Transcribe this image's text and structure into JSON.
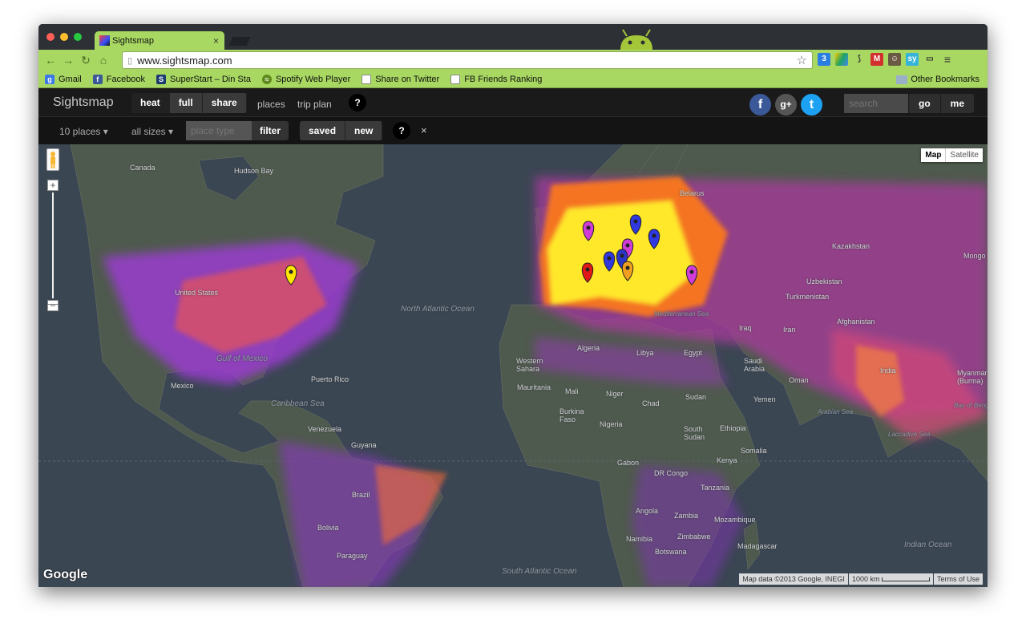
{
  "browser": {
    "tab_title": "Sightsmap",
    "tab_close": "×",
    "url": "www.sightsmap.com",
    "bookmarks": [
      {
        "label": "Gmail",
        "icon": "google-icon",
        "color": "#3b78e7"
      },
      {
        "label": "Facebook",
        "icon": "facebook-icon",
        "color": "#3b5998"
      },
      {
        "label": "SuperStart – Din Sta",
        "icon": "superstart-icon",
        "color": "#1d3b6e"
      },
      {
        "label": "Spotify Web Player",
        "icon": "spotify-icon",
        "color": "#5d8a1a"
      },
      {
        "label": "Share on Twitter",
        "icon": "page-icon",
        "color": "#ffffff"
      },
      {
        "label": "FB Friends Ranking",
        "icon": "page-icon",
        "color": "#ffffff"
      }
    ],
    "other_bookmarks": "Other Bookmarks",
    "extension_badge": "3"
  },
  "app": {
    "brand": "Sightsmap",
    "modes": [
      "heat",
      "full",
      "share"
    ],
    "links": [
      "places",
      "trip plan"
    ],
    "help": "?",
    "social": [
      {
        "glyph": "f",
        "icon": "facebook-icon",
        "color": "#3b5998"
      },
      {
        "glyph": "g+",
        "icon": "google-plus-icon",
        "color": "#555555"
      },
      {
        "glyph": "t",
        "icon": "twitter-icon",
        "color": "#1da1f2"
      }
    ],
    "search_placeholder": "search",
    "go": "go",
    "me": "me"
  },
  "filters": {
    "places": "10 places",
    "sizes": "all sizes",
    "place_type_placeholder": "place type",
    "filter": "filter",
    "saved": "saved",
    "new": "new",
    "help": "?",
    "close": "×"
  },
  "map": {
    "map_type": [
      "Map",
      "Satellite"
    ],
    "zoom_in": "+",
    "zoom_out": "−",
    "google": "Google",
    "attribution": "Map data ©2013 Google, INEGI",
    "scale": "1000 km",
    "terms": "Terms of Use",
    "labels": {
      "canada": "Canada",
      "hudson": "Hudson Bay",
      "north_atlantic": "North Atlantic Ocean",
      "gulf_mexico": "Gulf of Mexico",
      "mexico": "Mexico",
      "caribbean": "Caribbean Sea",
      "puerto_rico": "Puerto Rico",
      "venezuela": "Venezuela",
      "guyana": "Guyana",
      "brazil": "Brazil",
      "bolivia": "Bolivia",
      "paraguay": "Paraguay",
      "algeria": "Algeria",
      "libya": "Libya",
      "egypt": "Egypt",
      "western_sahara": "Western Sahara",
      "mauritania": "Mauritania",
      "mali": "Mali",
      "niger": "Niger",
      "chad": "Chad",
      "sudan": "Sudan",
      "burkina": "Burkina Faso",
      "nigeria": "Nigeria",
      "south_sudan": "South Sudan",
      "ethiopia": "Ethiopia",
      "somalia": "Somalia",
      "kenya": "Kenya",
      "gabon": "Gabon",
      "drc": "DR Congo",
      "tanzania": "Tanzania",
      "angola": "Angola",
      "zambia": "Zambia",
      "zimbabwe": "Zimbabwe",
      "mozambique": "Mozambique",
      "botswana": "Botswana",
      "namibia": "Namibia",
      "madagascar": "Madagascar",
      "saudi": "Saudi Arabia",
      "yemen": "Yemen",
      "oman": "Oman",
      "iraq": "Iraq",
      "iran": "Iran",
      "kazakhstan": "Kazakhstan",
      "uzbekistan": "Uzbekistan",
      "turkmenistan": "Turkmenistan",
      "afghanistan": "Afghanistan",
      "india": "India",
      "myanmar": "Myanmar (Burma)",
      "mongolia": "Mongo",
      "arabian_sea": "Arabian Sea",
      "bay_bengal": "Bay of Bengal",
      "indian_ocean": "Indian Ocean",
      "south_atlantic": "South Atlantic Ocean",
      "laccadive": "Laccadive Sea",
      "mediterranean": "Mediterranean Sea",
      "belarus": "Belarus",
      "united_states": "United States"
    },
    "pin_colors": [
      "#ffe600",
      "#d03cd8",
      "#3038e0",
      "#3038e0",
      "#d03cd8",
      "#3038e0",
      "#2b36c8",
      "#e01818",
      "#f0a020",
      "#d03cd8"
    ]
  }
}
